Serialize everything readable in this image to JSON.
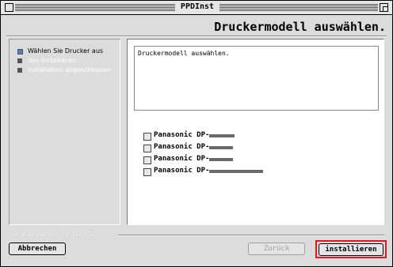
{
  "window": {
    "title": "PPDInst"
  },
  "header": {
    "heading": "Druckermodell auswählen."
  },
  "sidebar": {
    "steps": [
      {
        "label": "Wählen Sie Drucker aus",
        "color": "#5f7fa8"
      },
      {
        "label": "das Installieren",
        "color": "#555555"
      },
      {
        "label": "Installation abgeschlossen",
        "color": "#555555"
      }
    ]
  },
  "main": {
    "description": "Druckermodell auswählen.",
    "printers": [
      {
        "label": "Panasonic DP-"
      },
      {
        "label": "Panasonic DP-"
      },
      {
        "label": "Panasonic DP-"
      },
      {
        "label": "Panasonic DP-"
      }
    ]
  },
  "footer": {
    "label": "InstallAnywhere by Zero G",
    "cancel_label": "Abbrechen",
    "back_label": "Zurück",
    "install_label": "installieren"
  },
  "colors": {
    "highlight": "#e8141c"
  }
}
